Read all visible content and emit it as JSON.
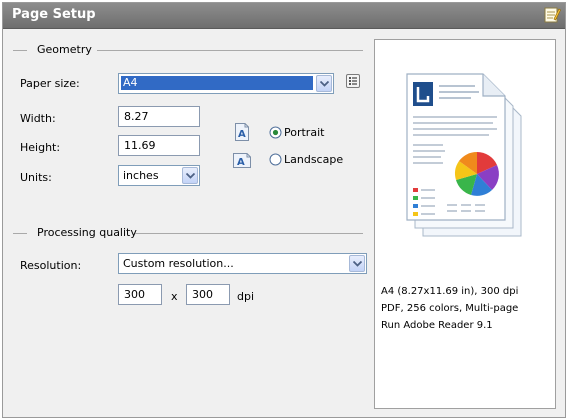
{
  "window": {
    "title": "Page Setup",
    "icon": "notepad-icon"
  },
  "geometry": {
    "label": "Geometry",
    "paper_size": {
      "label": "Paper size:",
      "value": "A4"
    },
    "width": {
      "label": "Width:",
      "value": "8.27"
    },
    "height": {
      "label": "Height:",
      "value": "11.69"
    },
    "units": {
      "label": "Units:",
      "value": "inches"
    },
    "orientation": {
      "portrait": {
        "label": "Portrait",
        "checked": true
      },
      "landscape": {
        "label": "Landscape",
        "checked": false
      }
    }
  },
  "processing": {
    "label": "Processing quality",
    "resolution": {
      "label": "Resolution:",
      "value": "Custom resolution..."
    },
    "res_x": "300",
    "times": "x",
    "res_y": "300",
    "unit": "dpi"
  },
  "preview": {
    "lines": [
      "A4 (8.27x11.69 in), 300 dpi",
      "PDF, 256 colors, Multi-page",
      "Run Adobe Reader 9.1"
    ]
  },
  "colors": {
    "accent": "#316ac5",
    "titlebar": "#7a7a7a"
  }
}
